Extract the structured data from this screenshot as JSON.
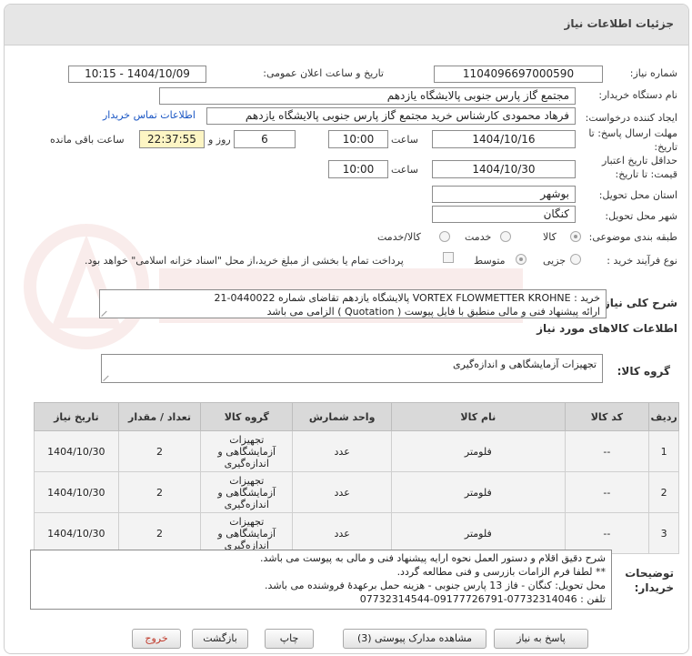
{
  "header": {
    "title": "جزئیات اطلاعات نیاز"
  },
  "fields": {
    "need_number_label": "شماره نیاز:",
    "need_number": "1104096697000590",
    "announce_label": "تاریخ و ساعت اعلان عمومی:",
    "announce_value": "1404/10/09 - 10:15",
    "buyer_org_label": "نام دستگاه خریدار:",
    "buyer_org": "مجتمع گاز پارس جنوبی  پالایشگاه یازدهم",
    "creator_label": "ایجاد کننده درخواست:",
    "creator": "فرهاد محمودی کارشناس خرید مجتمع گاز پارس جنوبی  پالایشگاه یازدهم",
    "contact_link": "اطلاعات تماس خریدار",
    "deadline_label_1": "مهلت ارسال پاسخ: تا",
    "deadline_label_2": "تاریخ:",
    "deadline_date": "1404/10/16",
    "time_word": "ساعت",
    "deadline_time": "10:00",
    "days": "6",
    "days_word": "روز و",
    "remaining": "22:37:55",
    "remaining_word": "ساعت باقی مانده",
    "validity_label_1": "حداقل تاریخ اعتبار",
    "validity_label_2": "قیمت: تا تاریخ:",
    "validity_date": "1404/10/30",
    "validity_time": "10:00",
    "province_label": "استان محل تحویل:",
    "province": "بوشهر",
    "city_label": "شهر محل تحویل:",
    "city": "کنگان",
    "category_label": "طبقه بندی موضوعی:",
    "category_options": [
      "کالا",
      "خدمت",
      "کالا/خدمت"
    ],
    "process_label": "نوع فرآیند خرید :",
    "process_options": [
      "جزیی",
      "متوسط"
    ],
    "payment_note": "پرداخت تمام یا بخشی از مبلغ خرید،از محل \"اسناد خزانه اسلامی\" خواهد بود."
  },
  "description": {
    "label": "شرح کلی نیاز:",
    "line1": "خرید : VORTEX FLOWMETTER KROHNE  پالایشگاه یازدهم تقاضای شماره 0440022-21",
    "line2": "ارائه پیشنهاد فنی و مالی منطبق با فایل پیوست ( Quotation ) الزامی می باشد"
  },
  "goods": {
    "section_title": "اطلاعات کالاهای مورد نیاز",
    "group_label": "گروه کالا:",
    "group_value": "تجهیزات آزمایشگاهی و اندازه‌گیری"
  },
  "table": {
    "headers": [
      "ردیف",
      "کد کالا",
      "نام کالا",
      "واحد شمارش",
      "گروه کالا",
      "تعداد / مقدار",
      "تاریخ نیاز"
    ],
    "rows": [
      {
        "row": "1",
        "code": "--",
        "name": "فلومتر",
        "unit": "عدد",
        "group_l1": "تجهیزات",
        "group_l2": "آزمایشگاهی و",
        "group_l3": "اندازه‌گیری",
        "qty": "2",
        "date": "1404/10/30"
      },
      {
        "row": "2",
        "code": "--",
        "name": "فلومتر",
        "unit": "عدد",
        "group_l1": "تجهیزات",
        "group_l2": "آزمایشگاهی و",
        "group_l3": "اندازه‌گیری",
        "qty": "2",
        "date": "1404/10/30"
      },
      {
        "row": "3",
        "code": "--",
        "name": "فلومتر",
        "unit": "عدد",
        "group_l1": "تجهیزات",
        "group_l2": "آزمایشگاهی و",
        "group_l3": "اندازه‌گیری",
        "qty": "2",
        "date": "1404/10/30"
      }
    ]
  },
  "buyer_notes": {
    "label_1": "توضیحات",
    "label_2": "خریدار:",
    "line1": "شرح دقیق اقلام و دستور العمل نحوه ارایه پیشنهاد فنی و مالی به پیوست می باشد.",
    "line2": "** لطفا فرم الزامات بازرسی و فنی مطالعه گردد.",
    "line3": "محل تحویل: کنگان - فاز 13 پارس جنوبی - هزینه حمل برعهدۀ فروشنده می باشد.",
    "line4": "تلفن : 07732314046-09177726791-07732314544"
  },
  "buttons": {
    "reply": "پاسخ به نیاز",
    "attachments": "مشاهده مدارک پیوستی (3)",
    "print": "چاپ",
    "back": "بازگشت",
    "exit": "خروج"
  },
  "colors": {
    "link": "#1a56c4",
    "remaining_bg": "#fdf5c4",
    "exit_text": "#c0392b",
    "header_bg": "#e6e6e6"
  }
}
